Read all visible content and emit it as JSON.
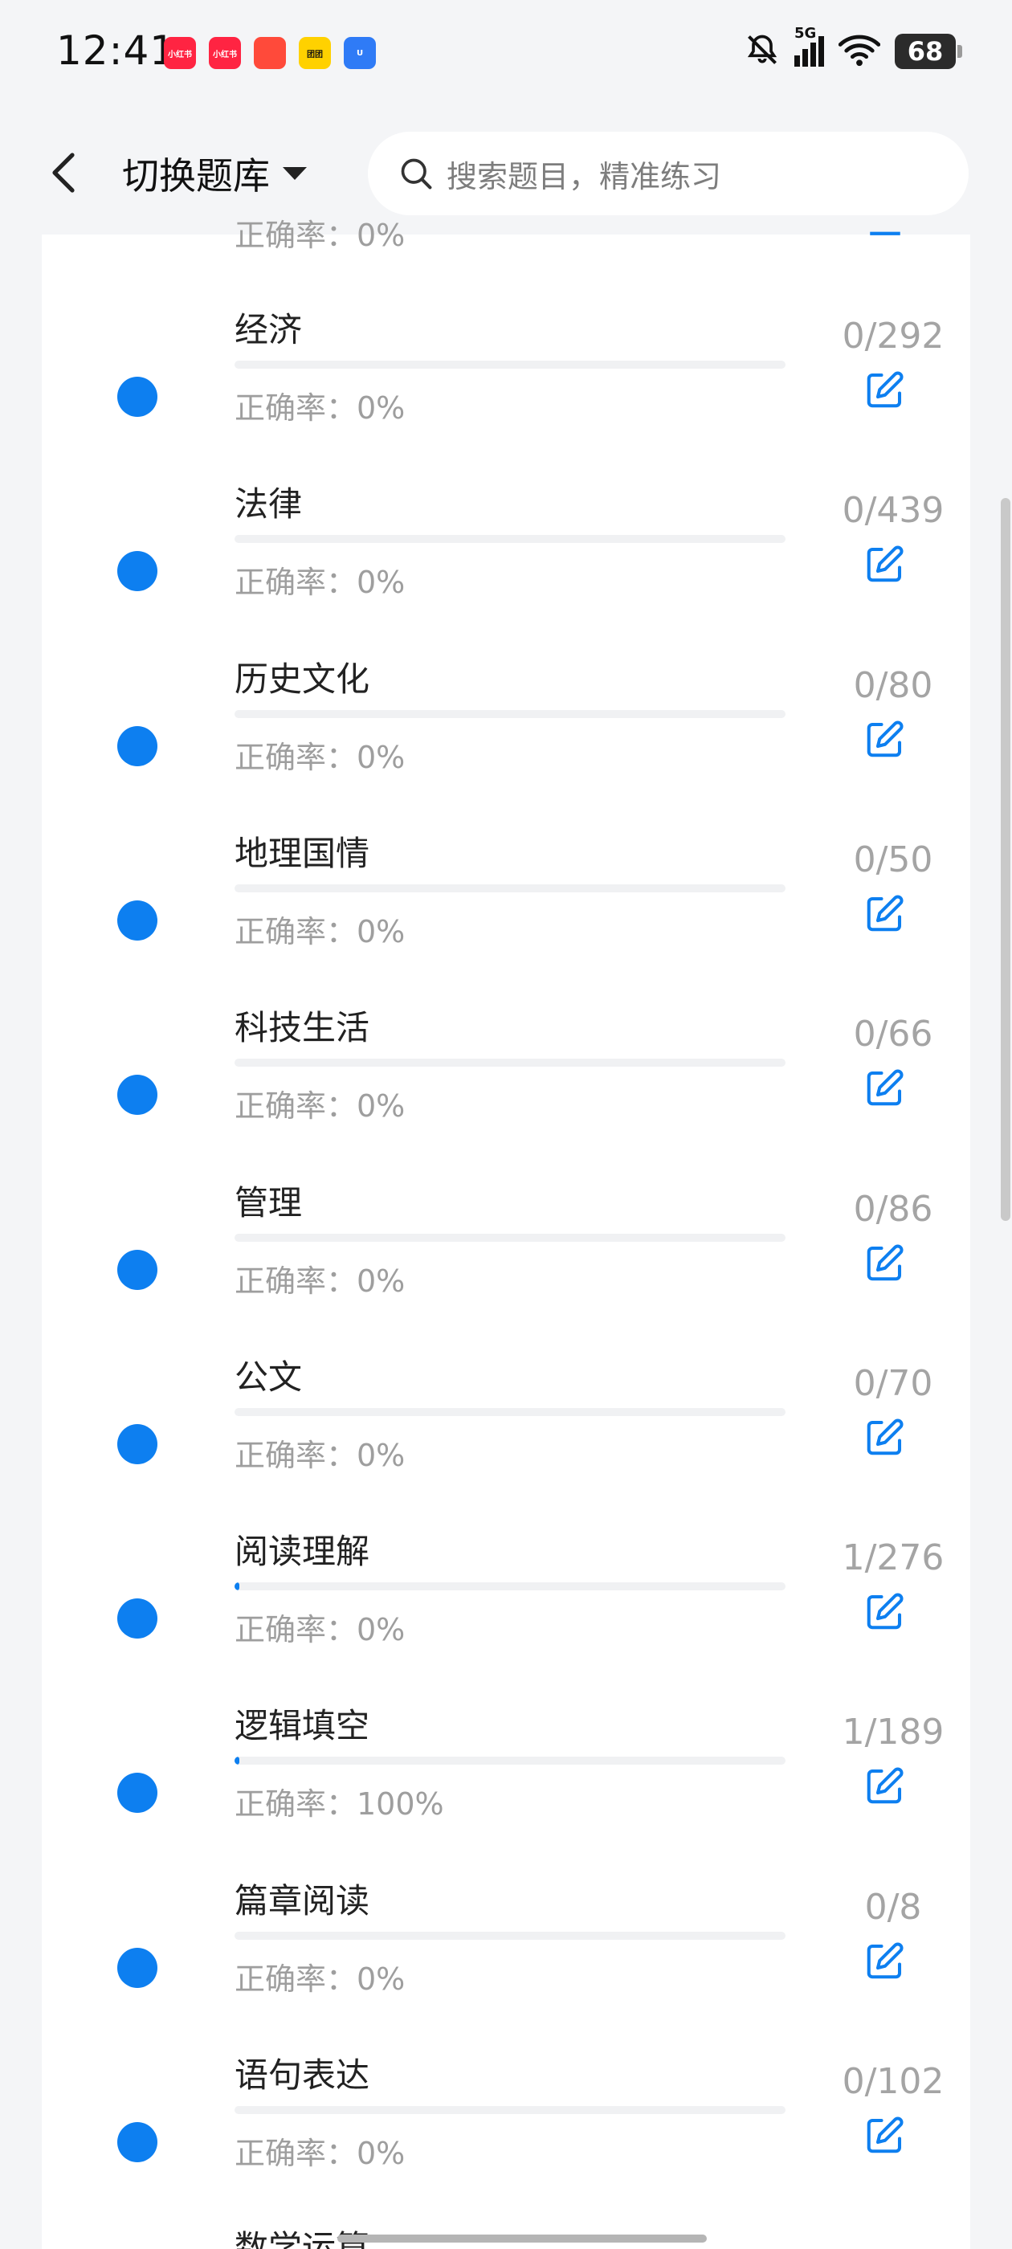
{
  "status_bar": {
    "time": "12:41",
    "app_icons": [
      {
        "name": "xiaohongshu-icon",
        "label": "小红书",
        "color": "#ff2442"
      },
      {
        "name": "xiaohongshu-icon-2",
        "label": "小红书",
        "color": "#ff2442"
      },
      {
        "name": "dingdong-icon",
        "label": "",
        "color": "#ff4a3a"
      },
      {
        "name": "meituan-icon",
        "label": "团团",
        "color": "#ffd100"
      },
      {
        "name": "app-u-icon",
        "label": "U",
        "color": "#2f7bf6"
      }
    ],
    "network": "5G",
    "battery": "68"
  },
  "header": {
    "switch_bank_label": "切换题库",
    "search_placeholder": "搜索题目，精准练习"
  },
  "list": {
    "partial_top_accuracy": "正确率：0%",
    "partial_bottom_name": "数学运算",
    "items": [
      {
        "name": "经济",
        "accuracy": "正确率：0%",
        "count": "0/292",
        "progress": 0
      },
      {
        "name": "法律",
        "accuracy": "正确率：0%",
        "count": "0/439",
        "progress": 0
      },
      {
        "name": "历史文化",
        "accuracy": "正确率：0%",
        "count": "0/80",
        "progress": 0
      },
      {
        "name": "地理国情",
        "accuracy": "正确率：0%",
        "count": "0/50",
        "progress": 0
      },
      {
        "name": "科技生活",
        "accuracy": "正确率：0%",
        "count": "0/66",
        "progress": 0
      },
      {
        "name": "管理",
        "accuracy": "正确率：0%",
        "count": "0/86",
        "progress": 0
      },
      {
        "name": "公文",
        "accuracy": "正确率：0%",
        "count": "0/70",
        "progress": 0
      },
      {
        "name": "阅读理解",
        "accuracy": "正确率：0%",
        "count": "1/276",
        "progress": 0.0036
      },
      {
        "name": "逻辑填空",
        "accuracy": "正确率：100%",
        "count": "1/189",
        "progress": 0.0053
      },
      {
        "name": "篇章阅读",
        "accuracy": "正确率：0%",
        "count": "0/8",
        "progress": 0
      },
      {
        "name": "语句表达",
        "accuracy": "正确率：0%",
        "count": "0/102",
        "progress": 0
      }
    ]
  },
  "colors": {
    "accent": "#0d7ff0",
    "muted_text": "#9e9e9e",
    "background": "#f4f5f7"
  }
}
